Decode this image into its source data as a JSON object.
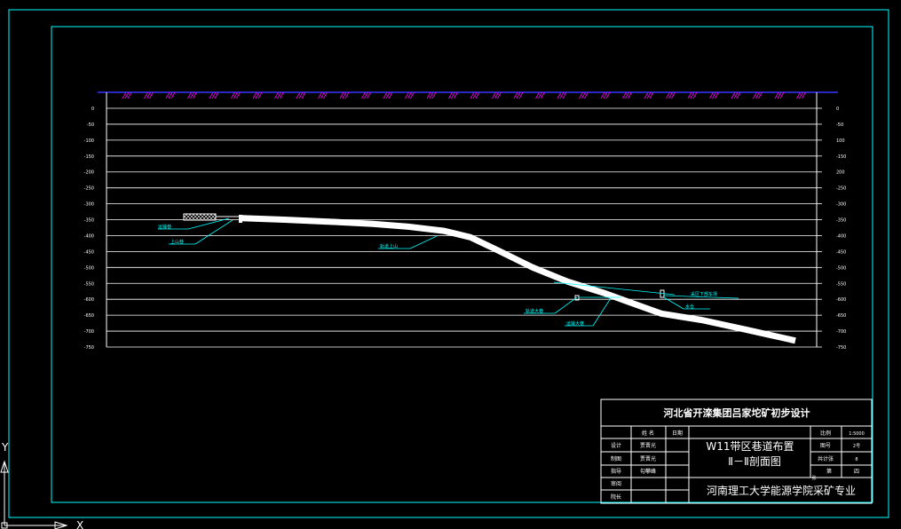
{
  "colors": {
    "background": "#000000",
    "frame": "#00ffff",
    "grid": "#ffffff",
    "surface": "#3333ff",
    "surface_hatch": "#ff00ff",
    "label": "#00ffff",
    "roadway": "#ffffff",
    "tick": "#ffffff"
  },
  "chart_data": {
    "type": "line",
    "title": "",
    "ylim": [
      -750,
      0
    ],
    "left_ticks": [
      "0",
      "-50",
      "-100",
      "-150",
      "-200",
      "-250",
      "-300",
      "-350",
      "-400",
      "-450",
      "-500",
      "-550",
      "-600",
      "-650",
      "-700",
      "-750"
    ],
    "right_ticks": [
      "0",
      "-50",
      "100",
      "-150",
      "200",
      "-250",
      "-300",
      "-350",
      "-400",
      "-450",
      "-500",
      "-550",
      "-600",
      "-650",
      "-700",
      "-750"
    ],
    "roadway_profile_elevation": [
      -345,
      -350,
      -356,
      -363,
      -372,
      -385,
      -405,
      -445,
      -500,
      -545,
      -580,
      -610,
      -645,
      -665,
      -695,
      -730
    ],
    "annotations": [
      "运输巷",
      "上山巷",
      "轨道上山",
      "轨道大巷",
      "运输大巷",
      "采区下部车场",
      "水仓"
    ]
  },
  "title_block": {
    "header": "河北省开滦集团吕家坨矿初步设计",
    "col_name": "姓  名",
    "col_date": "日期",
    "rows": [
      {
        "role": "设计",
        "name": "贾晋光"
      },
      {
        "role": "制图",
        "name": "贾晋光"
      },
      {
        "role": "指导",
        "name": "勾攀峰"
      },
      {
        "role": "审阅",
        "name": ""
      },
      {
        "role": "院长",
        "name": ""
      }
    ],
    "drawing_title_line1": "W11带区巷道布置",
    "drawing_title_line2": "Ⅱ－Ⅱ剖面图",
    "scale_label": "比例",
    "scale_value": "1:5000",
    "drawing_no_label": "图号",
    "drawing_no_value": "2号",
    "sheets_total_label": "共计张",
    "sheets_total_value": "8",
    "sheet_no_label": "第",
    "sheet_no_value": "四",
    "sheet_no_suffix": "张",
    "institution": "河南理工大学能源学院采矿专业"
  },
  "ucs": {
    "x": "X",
    "y": "Y"
  }
}
